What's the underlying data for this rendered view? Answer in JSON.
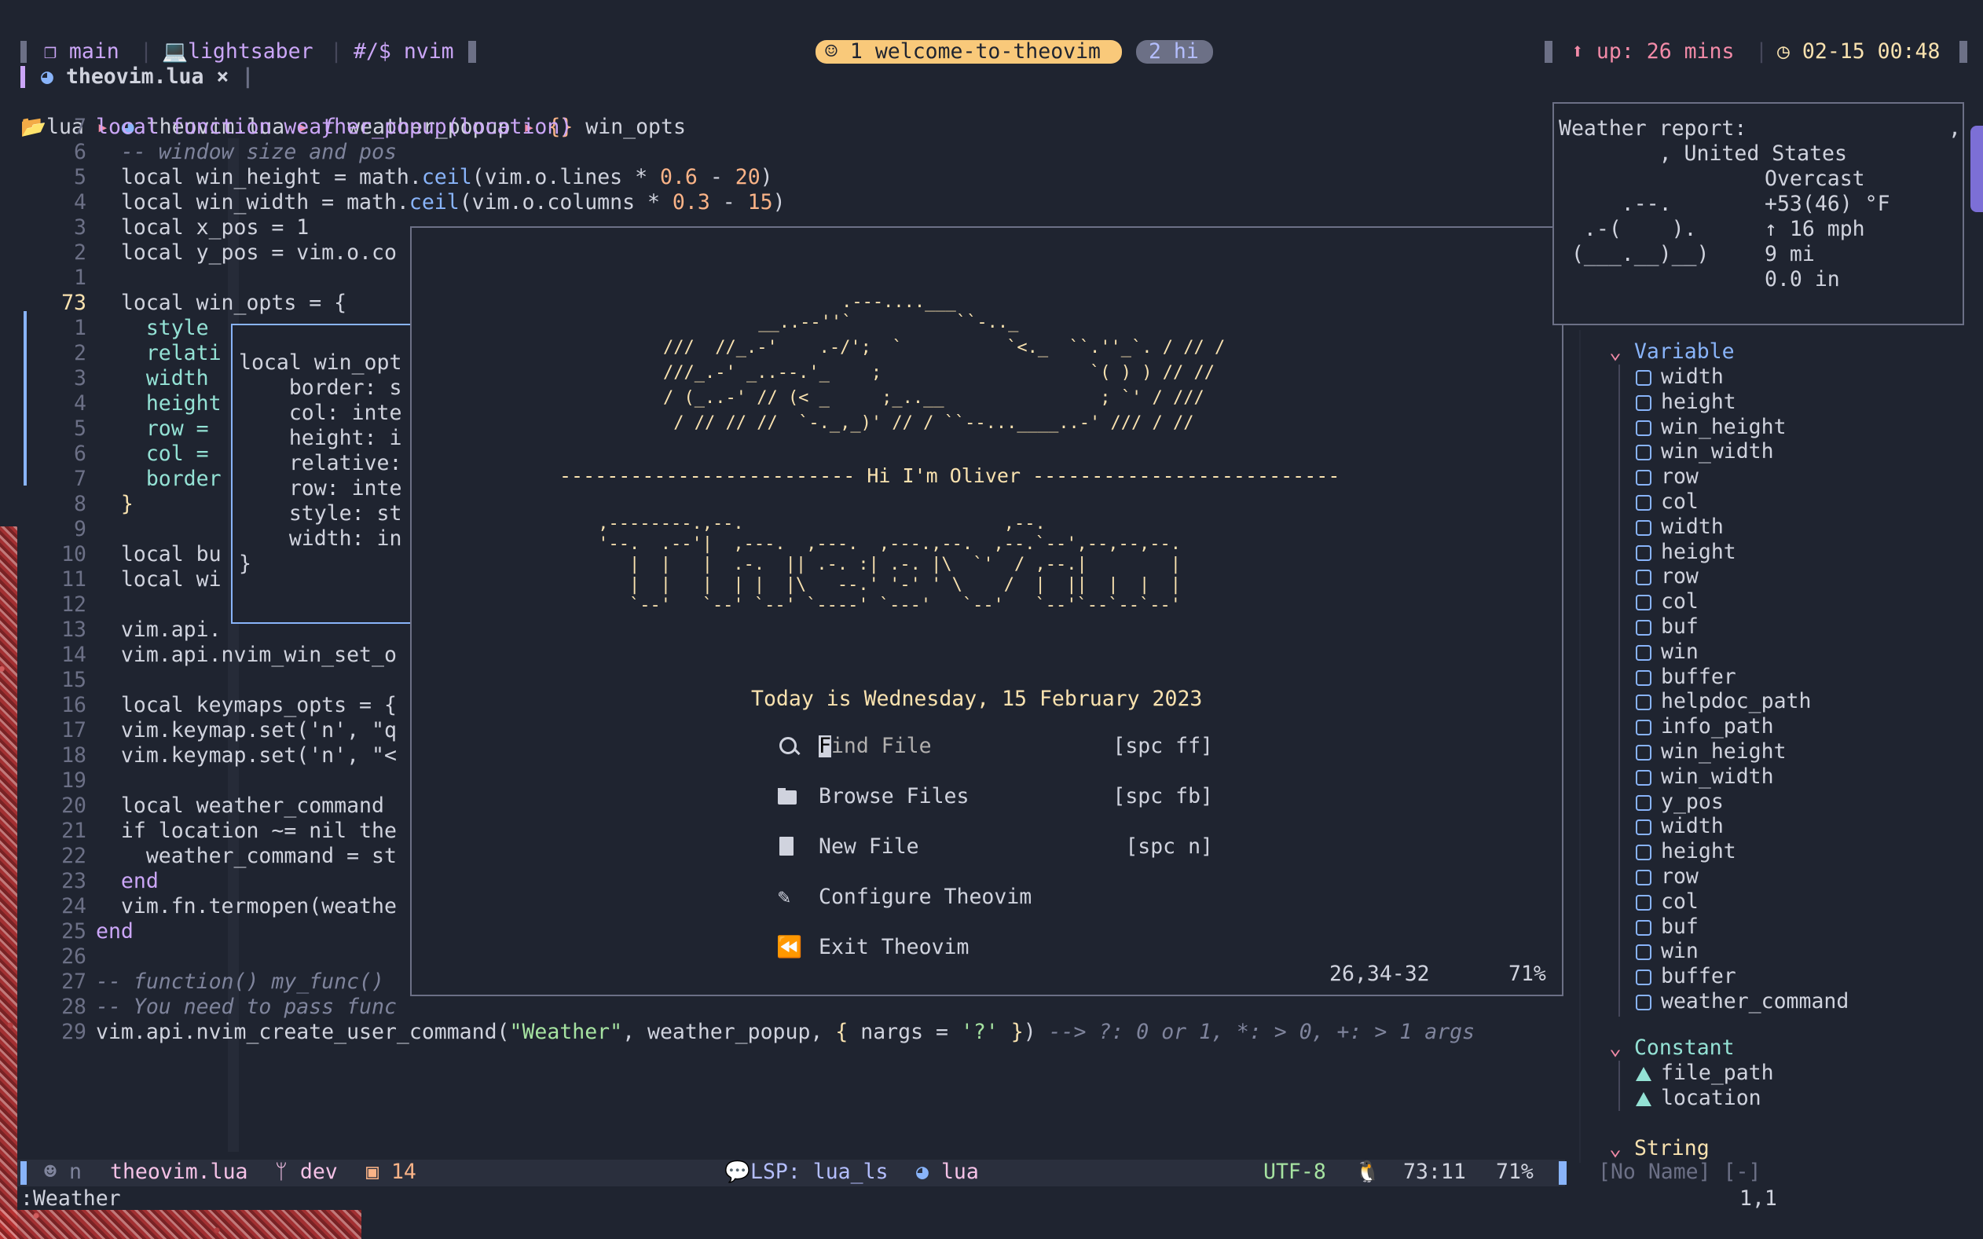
{
  "tmux": {
    "session": "main",
    "host": "lightsaber",
    "prompt": "#/$ nvim",
    "window_active": "1 welcome-to-theovim",
    "window_other": "2 hi",
    "uptime": "up: 26 mins",
    "datetime": "02-15 00:48"
  },
  "tabline": {
    "tab_name": "theovim.lua",
    "close": "×"
  },
  "breadcrumb": {
    "folder": "lua",
    "file": "theovim.lua",
    "func_icon": "ƒ",
    "func": "weather_popup",
    "obj_icon": "{}",
    "obj": "win_opts"
  },
  "editor": {
    "line_numbers": [
      "7",
      "6",
      "5",
      "4",
      "3",
      "2",
      "1",
      "73",
      "1",
      "2",
      "3",
      "4",
      "5",
      "6",
      "7",
      "8",
      "9",
      "10",
      "11",
      "12",
      "13",
      "14",
      "15",
      "16",
      "17",
      "18",
      "19",
      "20",
      "21",
      "22",
      "23",
      "24",
      "25",
      "26",
      "27",
      "28",
      "29"
    ],
    "lines": {
      "l1": "local function weather_popup(location)",
      "l2": "  -- window size and pos",
      "l3a": "  local win_height = math.",
      "l3b": "ceil",
      "l3c": "(vim.o.lines * ",
      "l3d": "0.6",
      "l3e": " - ",
      "l3f": "20",
      "l3g": ")",
      "l4a": "  local win_width = math.",
      "l4b": "ceil",
      "l4c": "(vim.o.columns * ",
      "l4d": "0.3",
      "l4e": " - ",
      "l4f": "15",
      "l4g": ")",
      "l5": "  local x_pos = 1",
      "l6": "  local y_pos = vim.o.co",
      "l8": "  local win_opts = {",
      "l9": "    style",
      "l10": "    relati",
      "l11": "    width",
      "l12": "    height",
      "l13": "    row =",
      "l14": "    col =",
      "l15": "    border",
      "l16": "  }",
      "l18": "  local bu",
      "l19": "  local wi",
      "l21": "  vim.api.",
      "l22": "  vim.api.nvim_win_set_o",
      "l24": "  local keymaps_opts = {",
      "l25": "  vim.keymap.set('n', \"q",
      "l26": "  vim.keymap.set('n', \"<",
      "l28": "  local weather_command",
      "l29": "  if location ~= nil the",
      "l30": "    weather_command = st",
      "l31": "  end",
      "l32": "  vim.fn.termopen(weathe",
      "l33": "end",
      "l35": "-- function() my_func()",
      "l36": "-- You need to pass func",
      "l37a": "vim.api.nvim_create_user_command(",
      "l37b": "\"Weather\"",
      "l37c": ", weather_popup, ",
      "l37d": "{",
      "l37e": " nargs = ",
      "l37f": "'?'",
      "l37g": " }",
      "l37h": ")",
      "l37i": " --> ?: 0 or 1, *: > 0, +: > 1 args"
    },
    "hover": {
      "h1": "local win_opt",
      "h2": "    border: s",
      "h3": "    col: inte",
      "h4": "    height: i",
      "h5": "    relative:",
      "h6": "    row: inte",
      "h7": "    style: st",
      "h8": "    width: in",
      "h9": "}"
    }
  },
  "dashboard": {
    "logo_ship": [
      "                 .---....___",
      "         __..--''`          ``-.._",
      "///  //_.-'    .-/';  `          `<._  ``.''_`. / // /",
      "///_.-' _..--.'_    ;                    `( ) ) // //",
      "/ (_..-' // (< _     ;_..__               ; `' / ///",
      " / // // //  `-._,_)' // / ``--...____..-' /// / //"
    ],
    "greeting": "------------------------- Hi I'm Oliver --------------------------",
    "logo_text": [
      " ,--------.,--.                         ,--.",
      " '--.  .--'|  ,---.  ,---.  ,---.,--.  ,--.`--',--,--,--.",
      "    |  |   |  .-.  || .-. :| .-. |\\  `'  / ,--.|        |",
      "    |  |   |  | |  |\\   --.' '-' ' \\    /  |  ||  |  |  |",
      "    `--'   `--' `--' `----' `---'   `--'   `--'`--`--`--'"
    ],
    "date": "Today is Wednesday, 15 February 2023",
    "items": [
      {
        "label": "Find File",
        "key": "[spc ff]"
      },
      {
        "label": "Browse Files",
        "key": "[spc fb]"
      },
      {
        "label": "New File",
        "key": "[spc n]"
      },
      {
        "label": "Configure Theovim",
        "key": ""
      },
      {
        "label": "Exit Theovim",
        "key": ""
      }
    ],
    "position": "26,34-32",
    "percent": "71%"
  },
  "weather": {
    "l1": "Weather report:",
    "l1b": ",",
    "l2": "        , United States",
    "art": [
      "",
      "     .--.",
      "  .-(    ).",
      " (___.__)__)",
      ""
    ],
    "cond": "Overcast",
    "temp": "+53(46) °F",
    "wind": "↑ 16 mph",
    "vis": "9 mi",
    "precip": "0.0 in"
  },
  "outline": {
    "variable_label": "Variable",
    "variables": [
      "width",
      "height",
      "win_height",
      "win_width",
      "row",
      "col",
      "width",
      "height",
      "row",
      "col",
      "buf",
      "win",
      "buffer",
      "helpdoc_path",
      "info_path",
      "win_height",
      "win_width",
      "y_pos",
      "width",
      "height",
      "row",
      "col",
      "buf",
      "win",
      "buffer",
      "weather_command"
    ],
    "constant_label": "Constant",
    "constants": [
      "file_path",
      "location"
    ],
    "string_label": "String"
  },
  "statusline": {
    "mode": "n",
    "file": "theovim.lua",
    "branch": "dev",
    "errors": "14",
    "lsp": "LSP: lua_ls",
    "filetype": "lua",
    "encoding": "UTF-8",
    "position": "73:11",
    "percent": "71%",
    "noname": "[No Name] [-]",
    "right_pos": "1,1"
  },
  "cmdline": {
    "text": ":Weather"
  },
  "colors": {
    "background": "#1f2430",
    "accent_yellow": "#f9e2af",
    "accent_purple": "#cba6f7",
    "accent_blue": "#89b4fa",
    "accent_red": "#f38ba8"
  }
}
